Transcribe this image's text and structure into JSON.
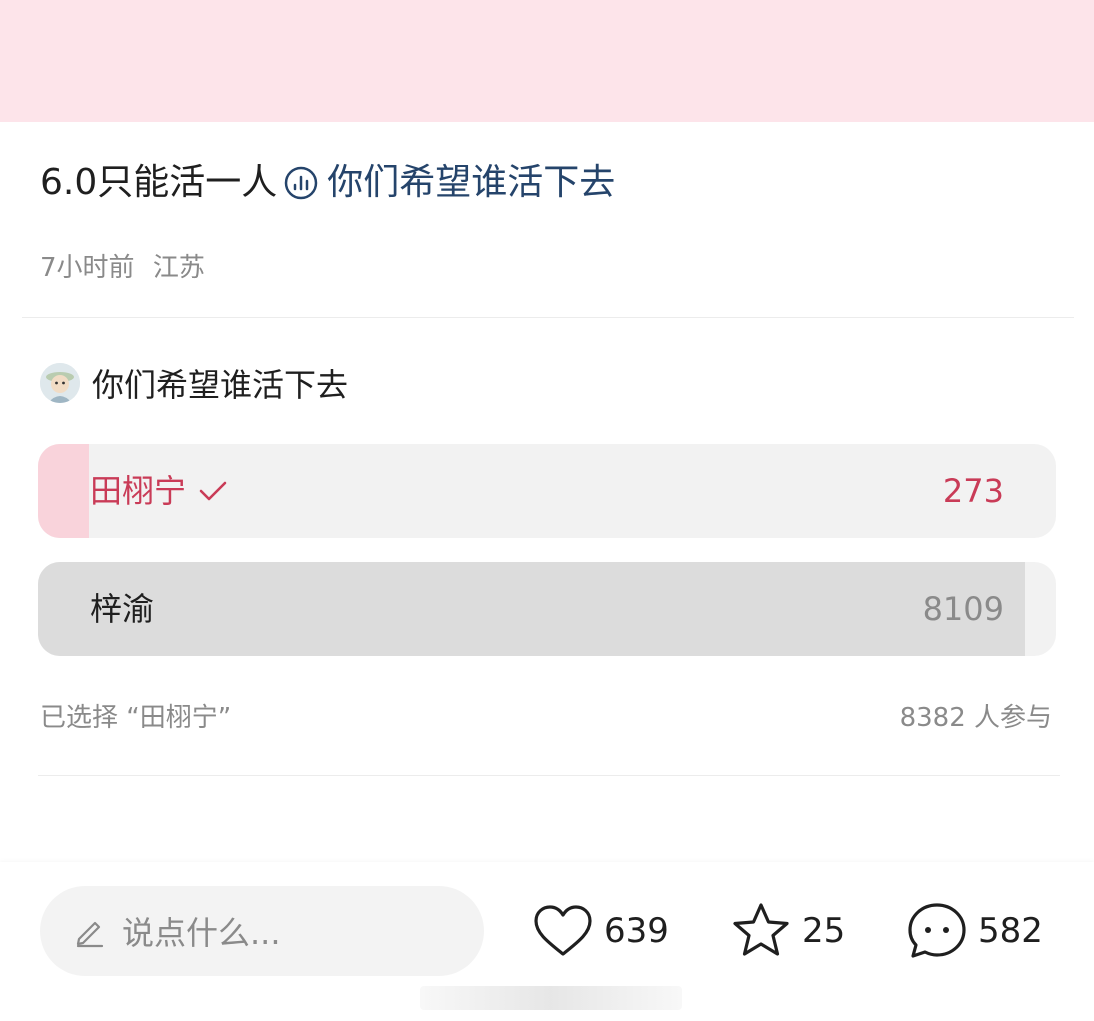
{
  "post": {
    "title_prefix": "6.0只能活一人",
    "topic_icon": "topic-chart-icon",
    "topic": "你们希望谁活下去",
    "time": "7小时前",
    "location": "江苏"
  },
  "poll": {
    "question": "你们希望谁活下去",
    "options": [
      {
        "label": "田栩宁",
        "count": "273",
        "share": 0.05,
        "selected": true
      },
      {
        "label": "梓渝",
        "count": "8109",
        "share": 0.97,
        "selected": false
      }
    ],
    "selected_text": "已选择 “田栩宁”",
    "participants": "8382 人参与"
  },
  "bottom_bar": {
    "input_placeholder": "说点什么...",
    "likes": "639",
    "stars": "25",
    "comments": "582"
  },
  "colors": {
    "banner": "#fde4ea",
    "selected_option": "#c93b57",
    "topic_text": "#25446b"
  }
}
